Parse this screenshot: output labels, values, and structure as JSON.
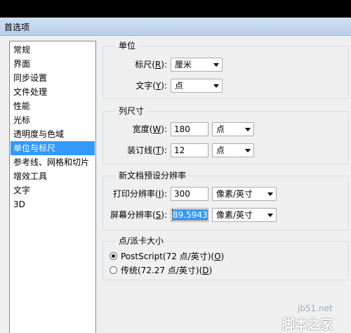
{
  "window": {
    "title": "首选项"
  },
  "sidebar": {
    "items": [
      "常规",
      "界面",
      "同步设置",
      "文件处理",
      "性能",
      "光标",
      "透明度与色域",
      "单位与标尺",
      "参考线、网格和切片",
      "增效工具",
      "文字",
      "3D"
    ],
    "selected": "单位与标尺"
  },
  "units": {
    "legend": "单位",
    "ruler_label": "标尺(",
    "ruler_key": "R",
    "ruler_value": "厘米",
    "type_label": "文字(",
    "type_key": "Y",
    "type_value": "点"
  },
  "column": {
    "legend": "列尺寸",
    "width_label": "宽度(",
    "width_key": "W",
    "width_value": "180",
    "width_unit": "点",
    "gutter_label": "装订线(",
    "gutter_key": "T",
    "gutter_value": "12",
    "gutter_unit": "点"
  },
  "newdoc": {
    "legend": "新文档预设分辨率",
    "print_label": "打印分辨率(",
    "print_key": "I",
    "print_value": "300",
    "print_unit": "像素/英寸",
    "screen_label": "屏幕分辨率(",
    "screen_key": "S",
    "screen_value": "89.5943",
    "screen_unit": "像素/英寸"
  },
  "pica": {
    "legend": "点/派卡大小",
    "postscript_label": "PostScript(72 点/英寸)(",
    "postscript_key": "O",
    "traditional_label": "传统(72.27 点/英寸)(",
    "traditional_key": "D",
    "selected": "postscript"
  },
  "watermark": {
    "url": "jb51.net",
    "brand": "脚本之家"
  },
  "punct": {
    "close": "):",
    "close_radio": ")"
  }
}
